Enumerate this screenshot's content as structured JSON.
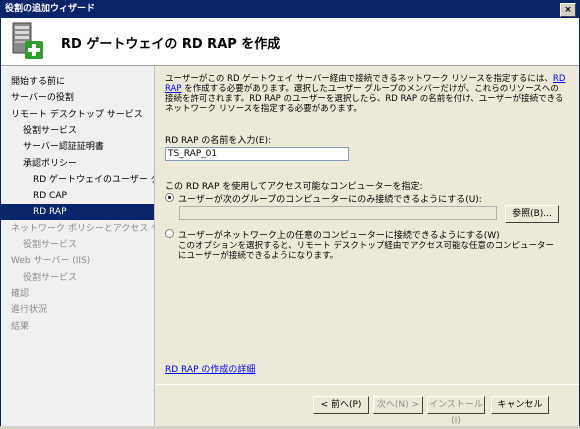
{
  "window": {
    "title": "役割の追加ウィザード",
    "close_glyph": "×"
  },
  "header": {
    "title": "RD ゲートウェイの RD RAP を作成",
    "icon": "server-add-icon"
  },
  "nav": [
    {
      "label": "開始する前に",
      "indent": 0,
      "state": "normal"
    },
    {
      "label": "サーバーの役割",
      "indent": 0,
      "state": "normal"
    },
    {
      "label": "リモート デスクトップ サービス",
      "indent": 0,
      "state": "normal"
    },
    {
      "label": "役割サービス",
      "indent": 1,
      "state": "normal"
    },
    {
      "label": "サーバー認証証明書",
      "indent": 1,
      "state": "normal"
    },
    {
      "label": "承認ポリシー",
      "indent": 1,
      "state": "normal"
    },
    {
      "label": "RD ゲートウェイのユーザー グ...",
      "indent": 2,
      "state": "normal"
    },
    {
      "label": "RD CAP",
      "indent": 2,
      "state": "normal"
    },
    {
      "label": "RD RAP",
      "indent": 2,
      "state": "selected"
    },
    {
      "label": "ネットワーク ポリシーとアクセス サービ...",
      "indent": 0,
      "state": "gray"
    },
    {
      "label": "役割サービス",
      "indent": 1,
      "state": "gray"
    },
    {
      "label": "Web サーバー (IIS)",
      "indent": 0,
      "state": "gray"
    },
    {
      "label": "役割サービス",
      "indent": 1,
      "state": "gray"
    },
    {
      "label": "確認",
      "indent": 0,
      "state": "gray"
    },
    {
      "label": "進行状況",
      "indent": 0,
      "state": "gray"
    },
    {
      "label": "結果",
      "indent": 0,
      "state": "gray"
    }
  ],
  "content": {
    "desc_part1": "ユーザーがこの RD ゲートウェイ サーバー経由で接続できるネットワーク リソースを指定するには、",
    "desc_link": "RD RAP",
    "desc_part2": " を作成する必要があります。選択したユーザー グループのメンバーだけが、これらのリソースへの接続を許可されます。RD RAP のユーザーを選択したら、RD RAP の名前を付け、ユーザーが接続できるネットワーク リソースを指定する必要があります。",
    "name_label": "RD RAP の名前を入力(E):",
    "name_value": "TS_RAP_01",
    "computers_label": "この RD RAP を使用してアクセス可能なコンピューターを指定:",
    "radio1_label": "ユーザーが次のグループのコンピューターにのみ接続できるようにする(U):",
    "group_value": "",
    "browse_label": "参照(B)...",
    "radio2_label": "ユーザーがネットワーク上の任意のコンピューターに接続できるようにする(W)",
    "radio2_desc": "このオプションを選択すると、リモート デスクトップ経由でアクセス可能な任意のコンピューターにユーザーが接続できるようになります。",
    "details_link": "RD RAP の作成の詳細"
  },
  "buttons": {
    "back": "< 前へ(P)",
    "next": "次へ(N) >",
    "install": "インストール(I)",
    "cancel": "キャンセル"
  }
}
